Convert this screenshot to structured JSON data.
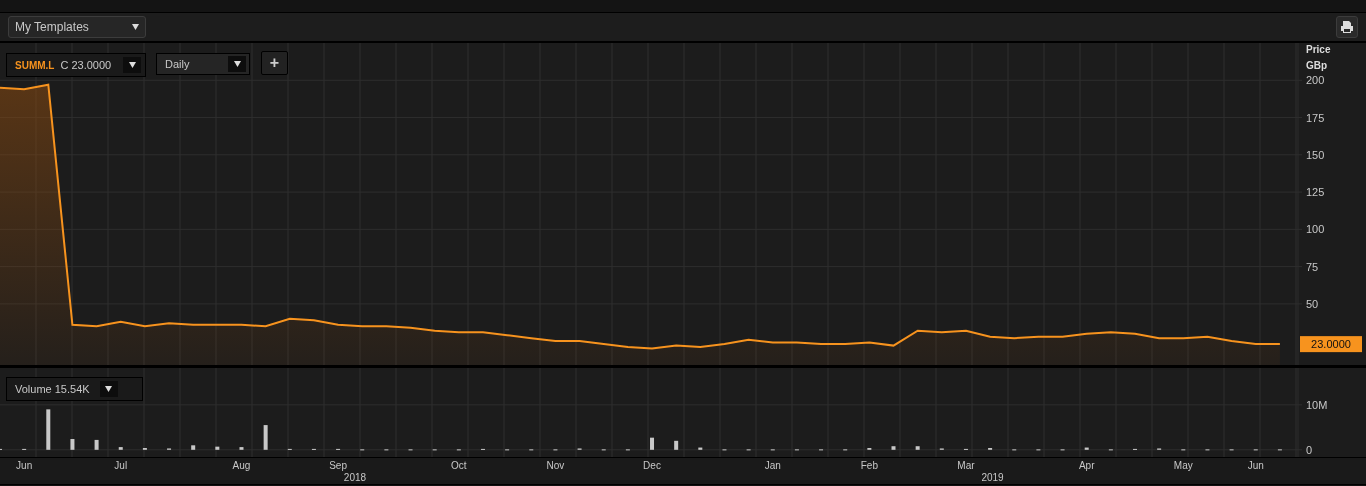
{
  "toolbar": {
    "template_menu": "My Templates"
  },
  "price_pane": {
    "legend": {
      "symbol": "SUMM.L",
      "close_label": "C",
      "close_value": "23.0000"
    },
    "interval": "Daily",
    "add_button": "+",
    "axis_title": "Price",
    "axis_unit": "GBp",
    "last_value": "23.0000",
    "chart_data": {
      "type": "area",
      "grid": true,
      "ylim": [
        9,
        225
      ],
      "yticks": [
        50,
        75,
        100,
        125,
        150,
        175,
        200
      ],
      "series": [
        {
          "color": "#f7931e",
          "values": [
            195,
            194,
            197,
            36,
            35,
            38,
            35,
            37,
            36,
            36,
            36,
            35,
            40,
            39,
            36,
            35,
            35,
            34,
            32,
            31,
            31,
            29,
            27,
            25,
            25,
            23,
            21,
            20,
            22,
            21,
            23,
            26,
            24,
            24,
            23,
            23,
            24,
            22,
            32,
            31,
            32,
            28,
            27,
            28,
            28,
            30,
            31,
            30,
            27,
            27,
            28,
            25,
            23,
            23
          ]
        }
      ]
    }
  },
  "volume_pane": {
    "legend": {
      "label": "Volume",
      "value": "15.54K"
    },
    "chart_data": {
      "type": "bar",
      "grid": true,
      "ylim": [
        -1.6,
        18.2
      ],
      "yticks": [
        {
          "value": 0,
          "label": "0"
        },
        {
          "value": 10,
          "label": "10M"
        }
      ],
      "categories": [
        null,
        "Jun",
        null,
        null,
        null,
        "Jul",
        null,
        null,
        null,
        null,
        "Aug",
        null,
        null,
        null,
        "Sep",
        null,
        null,
        null,
        null,
        "Oct",
        null,
        null,
        null,
        "Nov",
        null,
        null,
        null,
        "Dec",
        null,
        null,
        null,
        null,
        "Jan",
        null,
        null,
        null,
        "Feb",
        null,
        null,
        null,
        "Mar",
        null,
        null,
        null,
        null,
        "Apr",
        null,
        null,
        null,
        "May",
        null,
        null,
        "Jun",
        null
      ],
      "series": [
        {
          "color": "#c8c8c8",
          "values": [
            0.2,
            0.2,
            9,
            2.4,
            2.2,
            0.6,
            0.4,
            0.3,
            1,
            0.7,
            0.6,
            5.5,
            0.2,
            0.2,
            0.2,
            0.1,
            0.1,
            0.1,
            0.1,
            0.1,
            0.2,
            0.1,
            0.1,
            0.1,
            0.3,
            0.1,
            0.1,
            2.7,
            2,
            0.5,
            0.1,
            0.1,
            0.1,
            0.1,
            0.1,
            0.1,
            0.4,
            0.8,
            0.8,
            0.3,
            0.2,
            0.4,
            0.1,
            0.1,
            0.1,
            0.5,
            0.1,
            0.2,
            0.3,
            0.1,
            0.1,
            0.1,
            0.1,
            0.1
          ]
        }
      ]
    }
  },
  "x_axis": {
    "years": [
      "2018",
      "2019"
    ]
  }
}
